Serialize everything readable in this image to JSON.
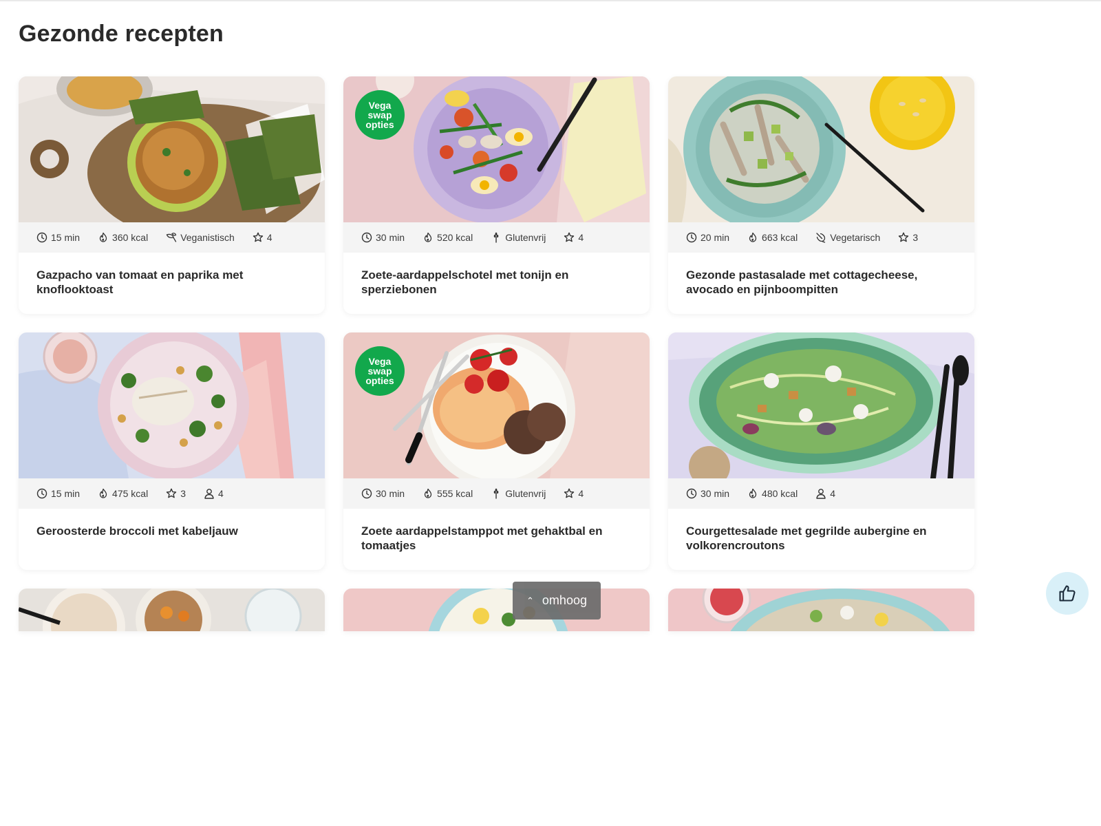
{
  "page": {
    "title": "Gezonde recepten"
  },
  "icons": {
    "time": "clock-icon",
    "calories": "flame-icon",
    "diet_vegan": "leaf-icon",
    "diet_glutenfree": "wheat-icon",
    "diet_vegetarian": "vegetarian-icon",
    "rating": "star-icon",
    "servings": "person-icon",
    "scroll_top": "chevron-up-icon",
    "feedback": "thumbs-up-icon"
  },
  "colors": {
    "badge_green": "#12a84c",
    "meta_background": "#f4f4f4",
    "feedback_bg": "#d9f0f8",
    "top_button_bg": "#6b6b6b"
  },
  "badge": {
    "line1": "Vega",
    "line2": "swap",
    "line3": "opties"
  },
  "recipes": [
    {
      "title": "Gazpacho van tomaat en paprika met knoflooktoast",
      "time": "15 min",
      "kcal": "360 kcal",
      "diet": "Veganistisch",
      "rating": "4"
    },
    {
      "title": "Zoete-aardappelschotel met tonijn en sperziebonen",
      "time": "30 min",
      "kcal": "520 kcal",
      "diet": "Glutenvrij",
      "rating": "4",
      "badge": true
    },
    {
      "title": "Gezonde pastasalade met cottagecheese, avocado en pijnboompitten",
      "time": "20 min",
      "kcal": "663 kcal",
      "diet": "Vegetarisch",
      "rating": "3"
    },
    {
      "title": "Geroosterde broccoli met kabeljauw",
      "time": "15 min",
      "kcal": "475 kcal",
      "rating": "3",
      "servings": "4"
    },
    {
      "title": "Zoete aardappelstamppot met gehaktbal en tomaatjes",
      "time": "30 min",
      "kcal": "555 kcal",
      "diet": "Glutenvrij",
      "rating": "4",
      "badge": true
    },
    {
      "title": "Courgettesalade met gegrilde aubergine en volkorencroutons",
      "time": "30 min",
      "kcal": "480 kcal",
      "servings": "4"
    }
  ],
  "scroll_top": {
    "label": "omhoog"
  }
}
